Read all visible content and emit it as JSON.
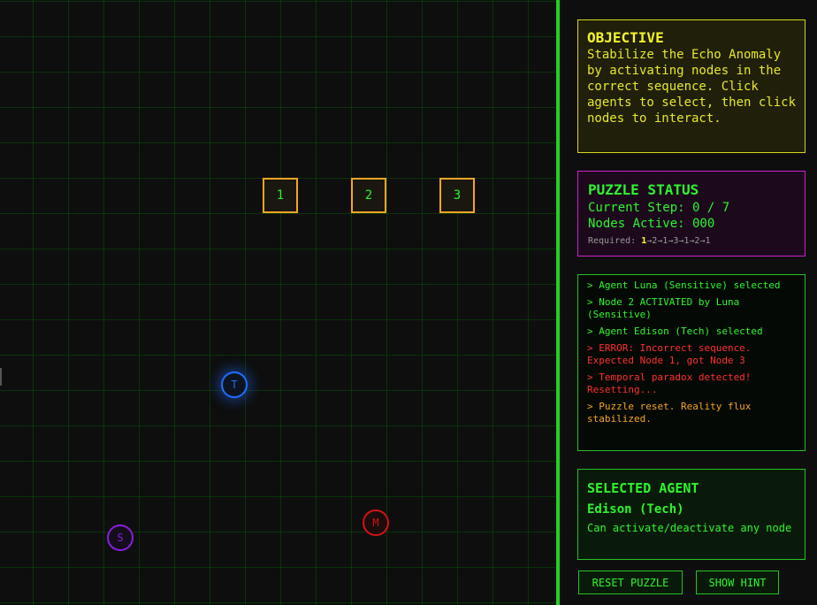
{
  "nodes": [
    {
      "label": "1"
    },
    {
      "label": "2"
    },
    {
      "label": "3"
    }
  ],
  "agents": {
    "tech": {
      "letter": "T",
      "color": "#1e6fff"
    },
    "sensitive": {
      "letter": "S",
      "color": "#8a1ee0"
    },
    "mech": {
      "letter": "M",
      "color": "#d21414"
    }
  },
  "objective": {
    "title": "OBJECTIVE",
    "text": "Stabilize the Echo Anomaly by activating nodes in the correct sequence. Click agents to select, then click nodes to interact."
  },
  "puzzle_status": {
    "title": "PUZZLE STATUS",
    "current_step": "Current Step: 0 / 7",
    "nodes_active": "Nodes Active: 000",
    "required_label": "Required: ",
    "required_first": "1",
    "required_rest": "→2→1→3→1→2→1"
  },
  "log": [
    {
      "text": "> Agent Luna (Sensitive) selected",
      "color": "#2ef52e"
    },
    {
      "text": "> Node 2 ACTIVATED by Luna (Sensitive)",
      "color": "#2ef52e"
    },
    {
      "text": "> Agent Edison (Tech) selected",
      "color": "#2ef52e"
    },
    {
      "text": "> ERROR: Incorrect sequence. Expected Node 1, got Node 3",
      "color": "#ff3030"
    },
    {
      "text": "> Temporal paradox detected! Resetting...",
      "color": "#ff3030"
    },
    {
      "text": "> Puzzle reset. Reality flux stabilized.",
      "color": "#f5a623"
    }
  ],
  "selected_agent": {
    "title": "SELECTED AGENT",
    "name": "Edison (Tech)",
    "description": "Can activate/deactivate any node"
  },
  "buttons": {
    "reset": "RESET PUZZLE",
    "hint": "SHOW HINT"
  },
  "colors": {
    "accent_green": "#2ef52e",
    "node_border": "#f5a623",
    "objective_border": "#d8d81e",
    "status_border": "#d21ed2",
    "error": "#ff3030"
  }
}
